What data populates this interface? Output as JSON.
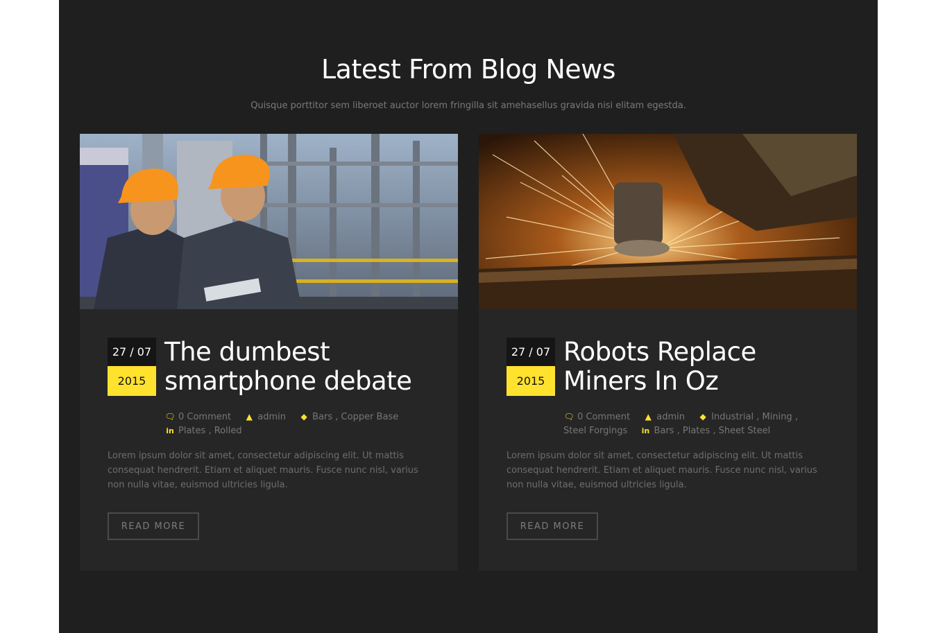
{
  "section": {
    "title": "Latest From Blog News",
    "subtitle": "Quisque porttitor sem liberoet auctor lorem fringilla sit amehasellus gravida nisi elitam egestda."
  },
  "colors": {
    "accent": "#ffe22e",
    "background": "#1f1f1f",
    "card": "#262626"
  },
  "posts": [
    {
      "image": "workers-in-hard-hats-photo",
      "date_day_month": "27 / 07",
      "date_year": "2015",
      "title": "The dumbest smartphone debate",
      "comments": "0 Comment",
      "author": "admin",
      "categories": [
        "Bars",
        ", Copper Base",
        "Plates",
        ", Rolled"
      ],
      "excerpt": "Lorem ipsum dolor sit amet, consectetur adipiscing elit. Ut mattis consequat hendrerit. Etiam et aliquet mauris. Fusce nunc nisl, varius non nulla vitae, euismod ultricies ligula.",
      "read_more": "READ MORE"
    },
    {
      "image": "angle-grinder-sparks-photo",
      "date_day_month": "27 / 07",
      "date_year": "2015",
      "title": "Robots Replace Miners In Oz",
      "comments": "0 Comment",
      "author": "admin",
      "categories": [
        "Industrial",
        ", Mining",
        ",",
        "Steel Forgings",
        "Bars",
        ", Plates",
        ", Sheet Steel"
      ],
      "excerpt": "Lorem ipsum dolor sit amet, consectetur adipiscing elit. Ut mattis consequat hendrerit. Etiam et aliquet mauris. Fusce nunc nisl, varius non nulla vitae, euismod ultricies ligula.",
      "read_more": "READ MORE"
    }
  ]
}
